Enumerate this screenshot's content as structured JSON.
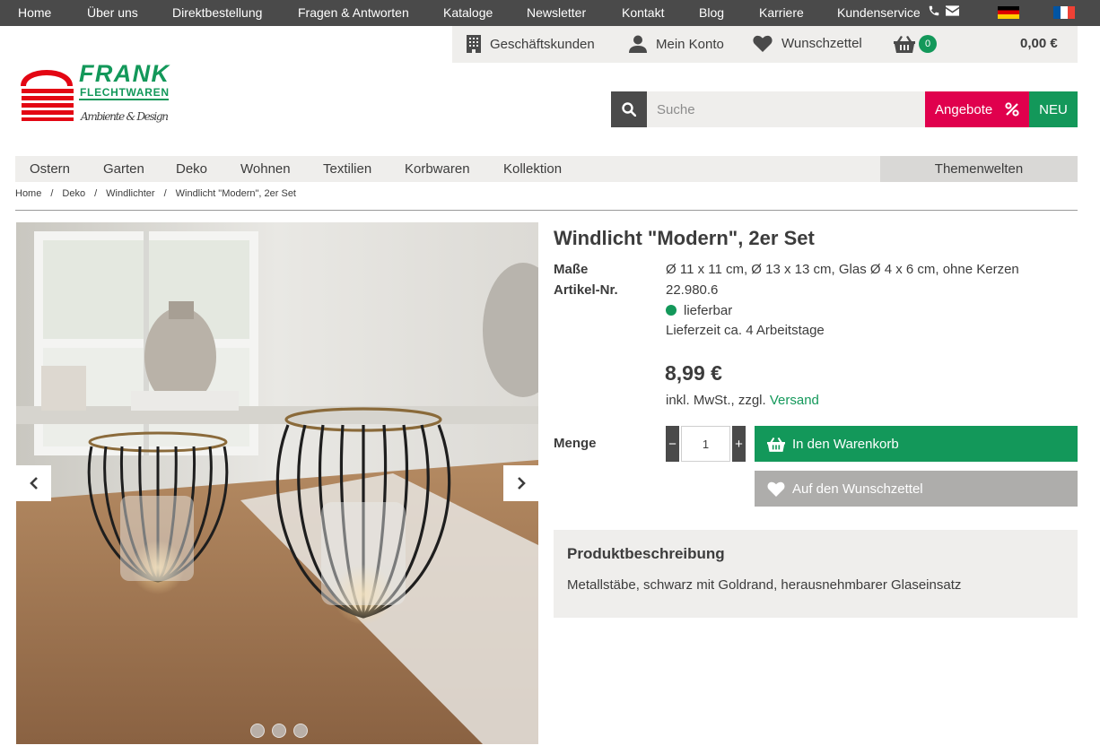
{
  "topbar": {
    "links": [
      "Home",
      "Über uns",
      "Direktbestellung",
      "Fragen & Antworten",
      "Kataloge",
      "Newsletter",
      "Kontakt",
      "Blog",
      "Karriere",
      "Kundenservice"
    ],
    "icons": [
      "phone-icon",
      "mail-icon"
    ],
    "flags": [
      "de-flag",
      "fr-flag"
    ]
  },
  "account": {
    "business": "Geschäftskunden",
    "my_account": "Mein Konto",
    "wishlist": "Wunschzettel",
    "cart_count": "0",
    "cart_total": "0,00 €"
  },
  "logo": {
    "name": "FRANK",
    "sub": "FLECHTWAREN",
    "tagline": "Ambiente & Design"
  },
  "search": {
    "placeholder": "Suche",
    "offers_label": "Angebote",
    "new_label": "NEU"
  },
  "nav": {
    "items": [
      "Ostern",
      "Garten",
      "Deko",
      "Wohnen",
      "Textilien",
      "Korbwaren",
      "Kollektion"
    ],
    "themen": "Themenwelten"
  },
  "breadcrumb": [
    "Home",
    "Deko",
    "Windlichter",
    "Windlicht \"Modern\", 2er Set"
  ],
  "product": {
    "title": "Windlicht \"Modern\", 2er Set",
    "dims_label": "Maße",
    "dims_value": "Ø 11 x 11 cm, Ø 13 x 13 cm, Glas Ø 4 x 6 cm, ohne Kerzen",
    "sku_label": "Artikel-Nr.",
    "sku_value": "22.980.6",
    "availability": "lieferbar",
    "delivery": "Lieferzeit ca. 4 Arbeitstage",
    "price": "8,99 €",
    "tax_prefix": "inkl. MwSt., zzgl.",
    "tax_link": "Versand",
    "qty_label": "Menge",
    "qty_value": "1",
    "minus": "−",
    "plus": "+",
    "add_to_cart": "In den Warenkorb",
    "add_to_wishlist": "Auf den Wunschzettel",
    "desc_title": "Produktbeschreibung",
    "desc_text": "Metallstäbe, schwarz mit Goldrand, herausnehmbarer Glaseinsatz"
  },
  "gallery": {
    "slide_count": 3,
    "active_slide": 1
  },
  "colors": {
    "green": "#13985a",
    "red": "#e0004d",
    "dark": "#4a4a4a",
    "light_bg": "#efeeec"
  }
}
